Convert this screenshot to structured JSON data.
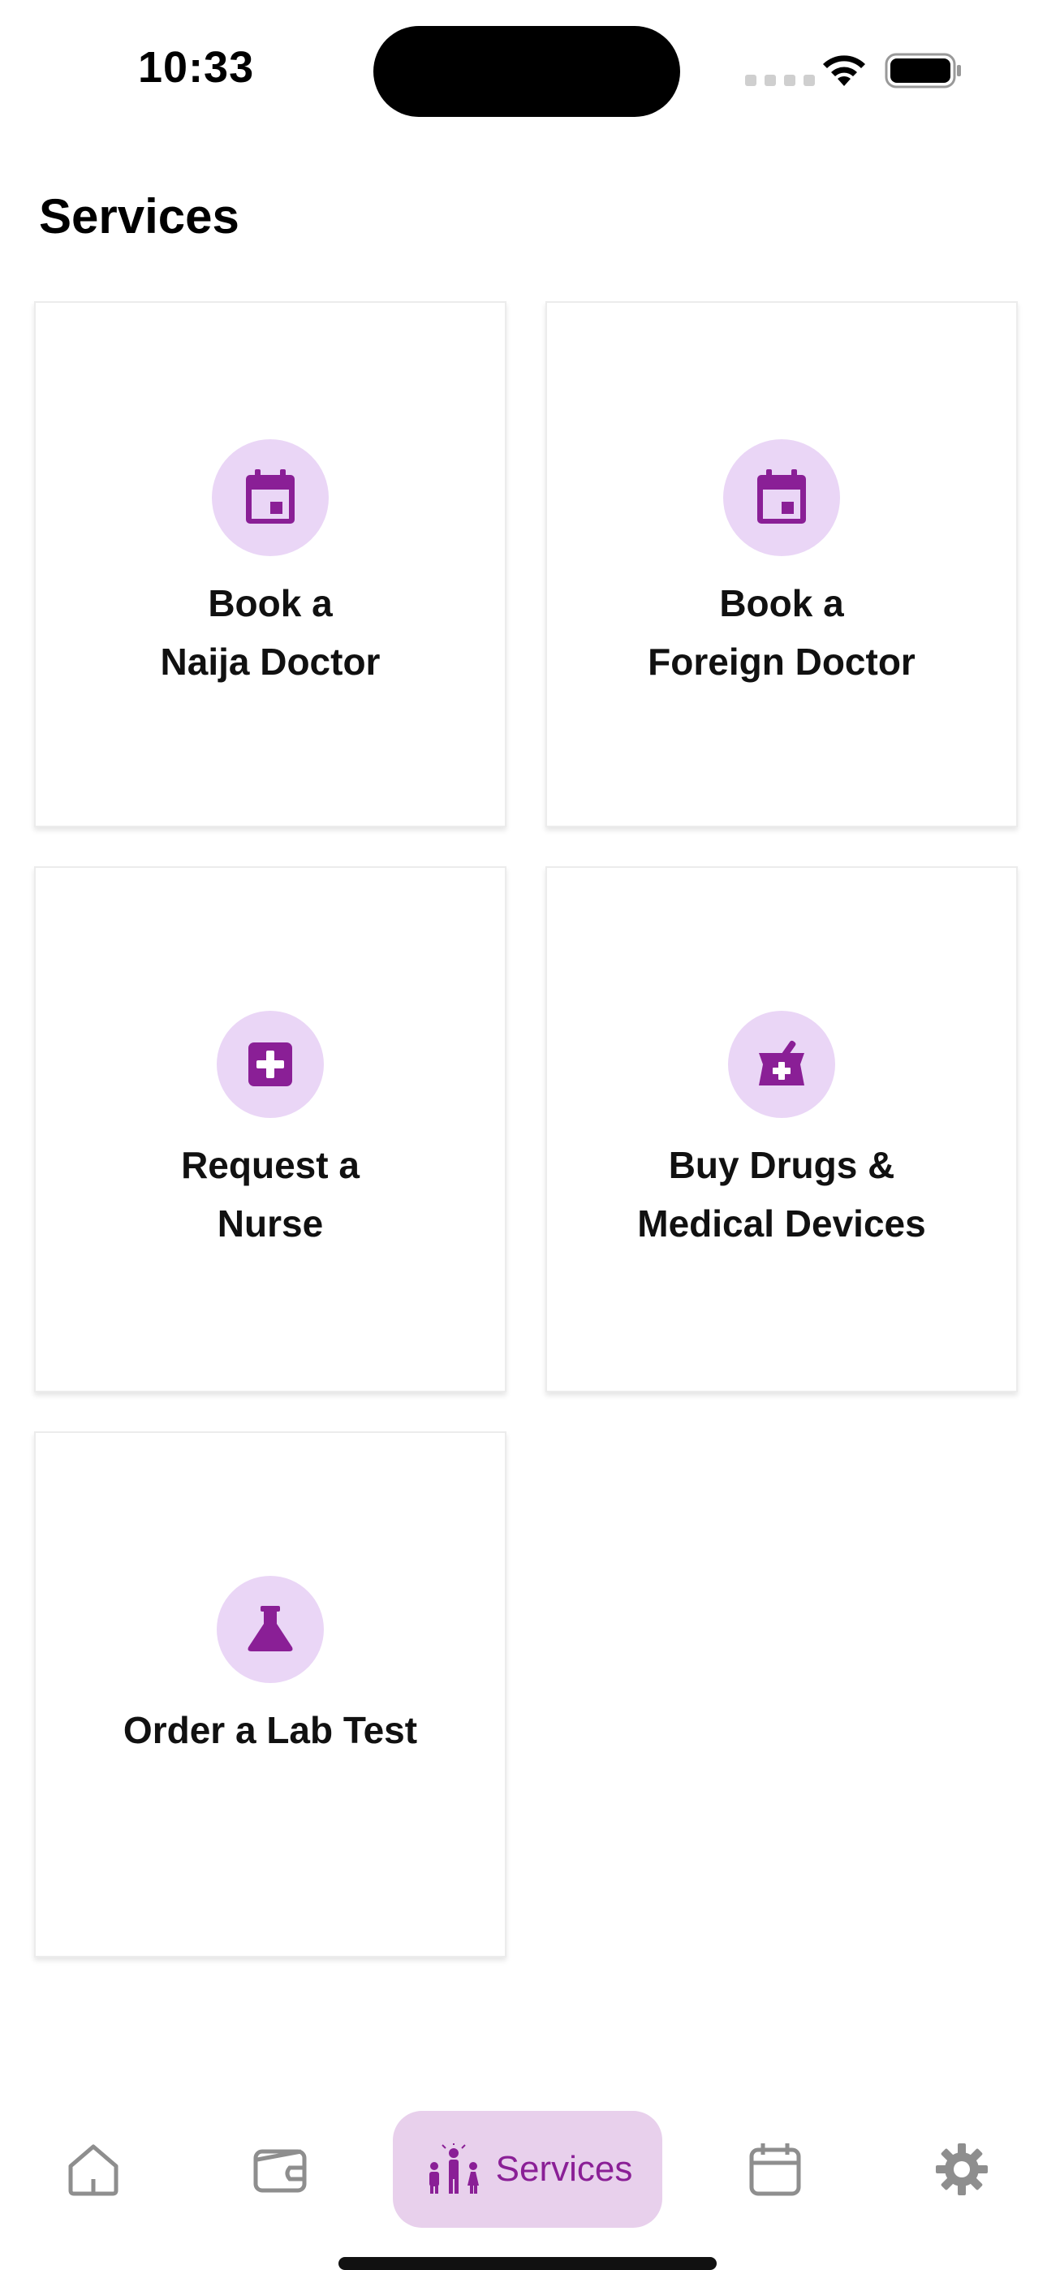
{
  "status_bar": {
    "time": "10:33"
  },
  "page": {
    "title": "Services"
  },
  "cards": [
    {
      "icon": "calendar-icon",
      "line1": "Book a",
      "line2": "Naija Doctor"
    },
    {
      "icon": "calendar-icon",
      "line1": "Book a",
      "line2": "Foreign Doctor"
    },
    {
      "icon": "medical-cross-icon",
      "line1": "Request a",
      "line2": "Nurse"
    },
    {
      "icon": "pharmacy-mortar-icon",
      "line1": "Buy Drugs &",
      "line2": "Medical Devices"
    },
    {
      "icon": "flask-icon",
      "line1": "Order a Lab Test",
      "line2": ""
    }
  ],
  "bottom_nav": {
    "items": [
      {
        "icon": "home-icon"
      },
      {
        "icon": "wallet-icon"
      },
      {
        "icon": "people-icon",
        "label": "Services",
        "active": true
      },
      {
        "icon": "calendar-icon"
      },
      {
        "icon": "gear-icon"
      }
    ]
  },
  "colors": {
    "accent": "#8a1f96",
    "icon_bg": "#ead6f6",
    "active_nav_bg": "#e8d0ec",
    "nav_inactive": "#8e8e8e"
  }
}
